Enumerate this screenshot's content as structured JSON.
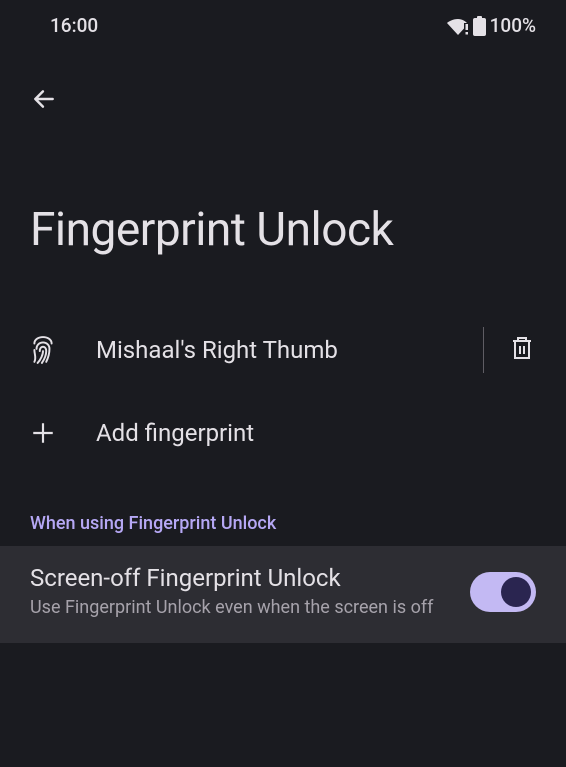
{
  "status": {
    "time": "16:00",
    "battery": "100%"
  },
  "page": {
    "title": "Fingerprint Unlock"
  },
  "fingerprints": [
    {
      "label": "Mishaal's Right Thumb"
    }
  ],
  "actions": {
    "add_label": "Add fingerprint"
  },
  "section": {
    "header": "When using Fingerprint Unlock"
  },
  "settings": {
    "screen_off": {
      "title": "Screen-off Fingerprint Unlock",
      "desc": "Use Fingerprint Unlock even when the screen is off",
      "enabled": true
    }
  }
}
